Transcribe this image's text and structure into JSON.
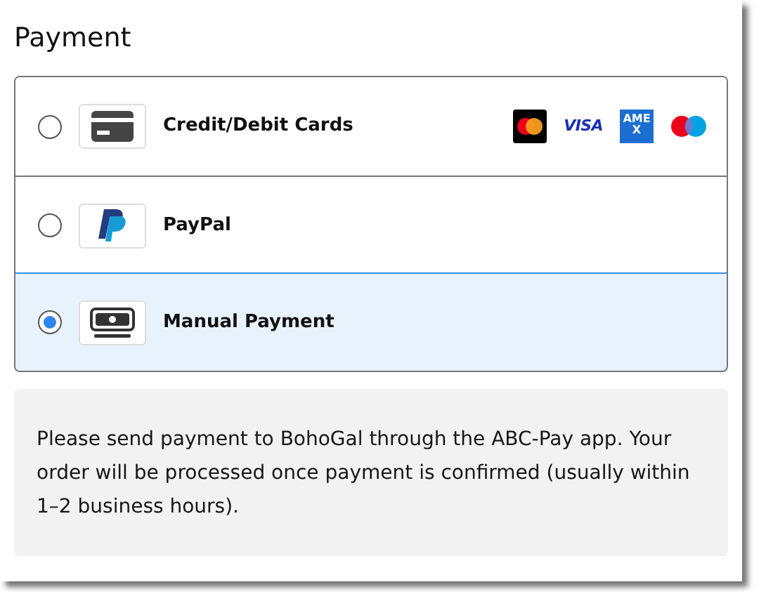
{
  "title": "Payment",
  "options": [
    {
      "kind": "card",
      "label": "Credit/Debit Cards",
      "selected": false,
      "brands": [
        {
          "kind": "mastercard"
        },
        {
          "kind": "visa",
          "text": "VISA"
        },
        {
          "kind": "amex",
          "text": "AMEX"
        },
        {
          "kind": "maestro"
        }
      ]
    },
    {
      "kind": "paypal",
      "label": "PayPal",
      "selected": false
    },
    {
      "kind": "cash",
      "label": "Manual Payment",
      "selected": true
    }
  ],
  "note": "Please send payment to BohoGal through the ABC-Pay app. Your order will be processed once payment is confirmed (usually within 1–2 business hours)."
}
